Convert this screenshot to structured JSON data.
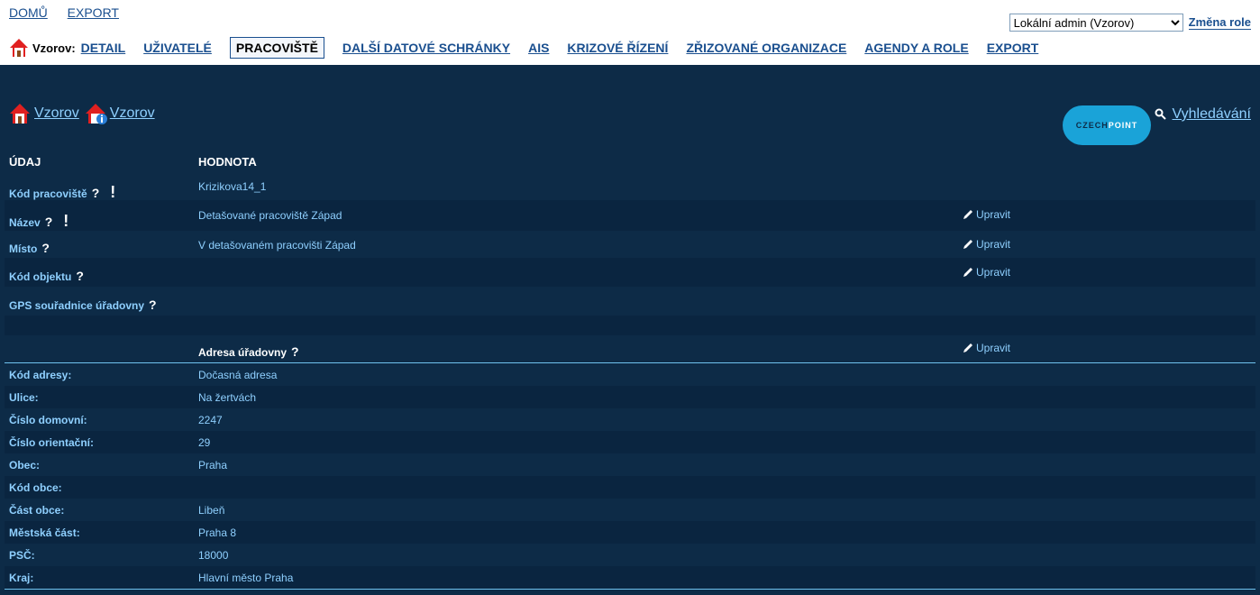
{
  "top_links": [
    "DOMŮ",
    "EXPORT"
  ],
  "role": {
    "selected": "Lokální admin (Vzorov)",
    "change_label": "Změna role"
  },
  "nav": {
    "context": "Vzorov:",
    "items": [
      "DETAIL",
      "UŽIVATELÉ",
      "PRACOVIŠTĚ",
      "DALŠÍ DATOVÉ SCHRÁNKY",
      "AIS",
      "KRIZOVÉ ŘÍZENÍ",
      "ZŘIZOVANÉ ORGANIZACE",
      "AGENDY A ROLE",
      "EXPORT"
    ],
    "active": "PRACOVIŠTĚ"
  },
  "breadcrumb": [
    "Vzorov",
    "Vzorov"
  ],
  "logo": {
    "part1": "CZECH",
    "part2": "POINT"
  },
  "search_label": "Vyhledávání",
  "table": {
    "col_label": "ÚDAJ",
    "col_value": "HODNOTA",
    "edit_label": "Upravit",
    "rows": [
      {
        "label": "Kód pracoviště",
        "value": "Krizikova14_1"
      },
      {
        "label": "Název",
        "value": "Detašované pracoviště Západ"
      },
      {
        "label": "Místo",
        "value": "V detašovaném pracovišti Západ"
      },
      {
        "label": "Kód objektu",
        "value": ""
      },
      {
        "label": "GPS souřadnice úřadovny",
        "value": ""
      }
    ],
    "address_title": "Adresa úřadovny",
    "address_rows": [
      {
        "label": "Kód adresy:",
        "value": "Dočasná adresa"
      },
      {
        "label": "Ulice:",
        "value": "Na žertvách"
      },
      {
        "label": "Číslo domovní:",
        "value": "2247"
      },
      {
        "label": "Číslo orientační:",
        "value": "29"
      },
      {
        "label": "Obec:",
        "value": "Praha"
      },
      {
        "label": "Kód obce:",
        "value": ""
      },
      {
        "label": "Část obce:",
        "value": "Libeň"
      },
      {
        "label": "Městská část:",
        "value": "Praha 8"
      },
      {
        "label": "PSČ:",
        "value": "18000"
      },
      {
        "label": "Kraj:",
        "value": "Hlavní město Praha"
      }
    ]
  },
  "colors": {
    "background": "#0d2b47",
    "link": "#8fd0ff",
    "accent": "#1aa3d8"
  }
}
